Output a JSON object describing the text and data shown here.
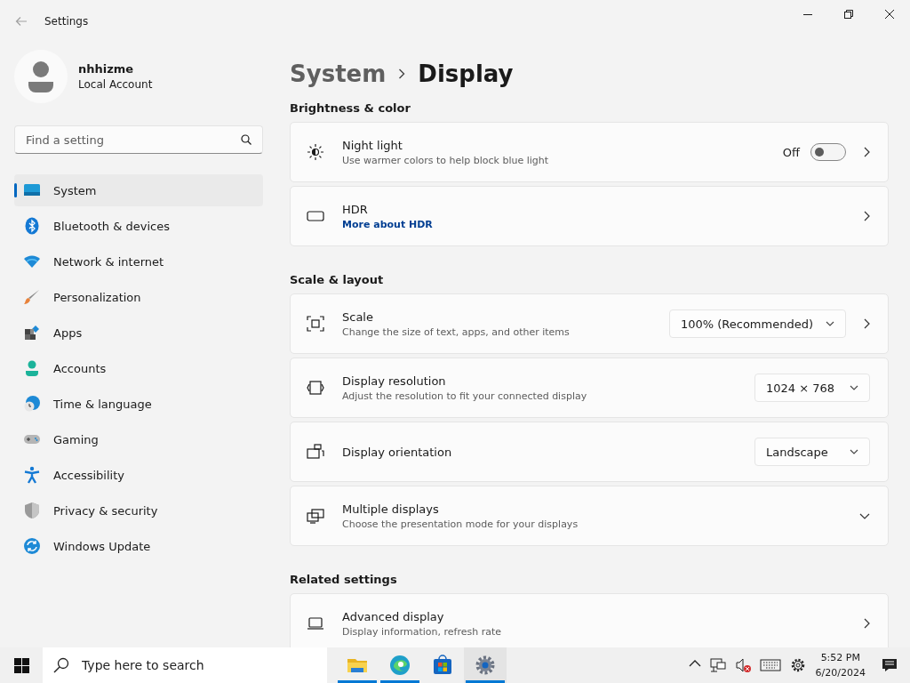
{
  "window": {
    "title": "Settings"
  },
  "account": {
    "name": "nhhizme",
    "type": "Local Account"
  },
  "search": {
    "placeholder": "Find a setting"
  },
  "sidebar": {
    "items": [
      {
        "label": "System",
        "selected": true
      },
      {
        "label": "Bluetooth & devices",
        "selected": false
      },
      {
        "label": "Network & internet",
        "selected": false
      },
      {
        "label": "Personalization",
        "selected": false
      },
      {
        "label": "Apps",
        "selected": false
      },
      {
        "label": "Accounts",
        "selected": false
      },
      {
        "label": "Time & language",
        "selected": false
      },
      {
        "label": "Gaming",
        "selected": false
      },
      {
        "label": "Accessibility",
        "selected": false
      },
      {
        "label": "Privacy & security",
        "selected": false
      },
      {
        "label": "Windows Update",
        "selected": false
      }
    ]
  },
  "breadcrumb": {
    "parent": "System",
    "current": "Display"
  },
  "sections": [
    {
      "heading": "Brightness & color",
      "cards": [
        {
          "title": "Night light",
          "subtitle": "Use warmer colors to help block blue light",
          "control": {
            "kind": "toggle",
            "label": "Off",
            "on": false
          },
          "navigable": true
        },
        {
          "title": "HDR",
          "link": "More about HDR",
          "navigable": true
        }
      ]
    },
    {
      "heading": "Scale & layout",
      "cards": [
        {
          "title": "Scale",
          "subtitle": "Change the size of text, apps, and other items",
          "control": {
            "kind": "dropdown",
            "value": "100% (Recommended)"
          },
          "navigable": true
        },
        {
          "title": "Display resolution",
          "subtitle": "Adjust the resolution to fit your connected display",
          "control": {
            "kind": "dropdown",
            "value": "1024 × 768"
          }
        },
        {
          "title": "Display orientation",
          "control": {
            "kind": "dropdown",
            "value": "Landscape"
          }
        },
        {
          "title": "Multiple displays",
          "subtitle": "Choose the presentation mode for your displays",
          "expandable": true
        }
      ]
    },
    {
      "heading": "Related settings",
      "cards": [
        {
          "title": "Advanced display",
          "subtitle": "Display information, refresh rate",
          "navigable": true
        }
      ]
    }
  ],
  "taskbar": {
    "search_placeholder": "Type here to search",
    "apps": [
      {
        "running": true,
        "selected": false
      },
      {
        "running": true,
        "selected": false
      },
      {
        "running": false,
        "selected": false
      },
      {
        "running": true,
        "selected": true
      }
    ],
    "time": "5:52 PM",
    "date": "6/20/2024"
  }
}
